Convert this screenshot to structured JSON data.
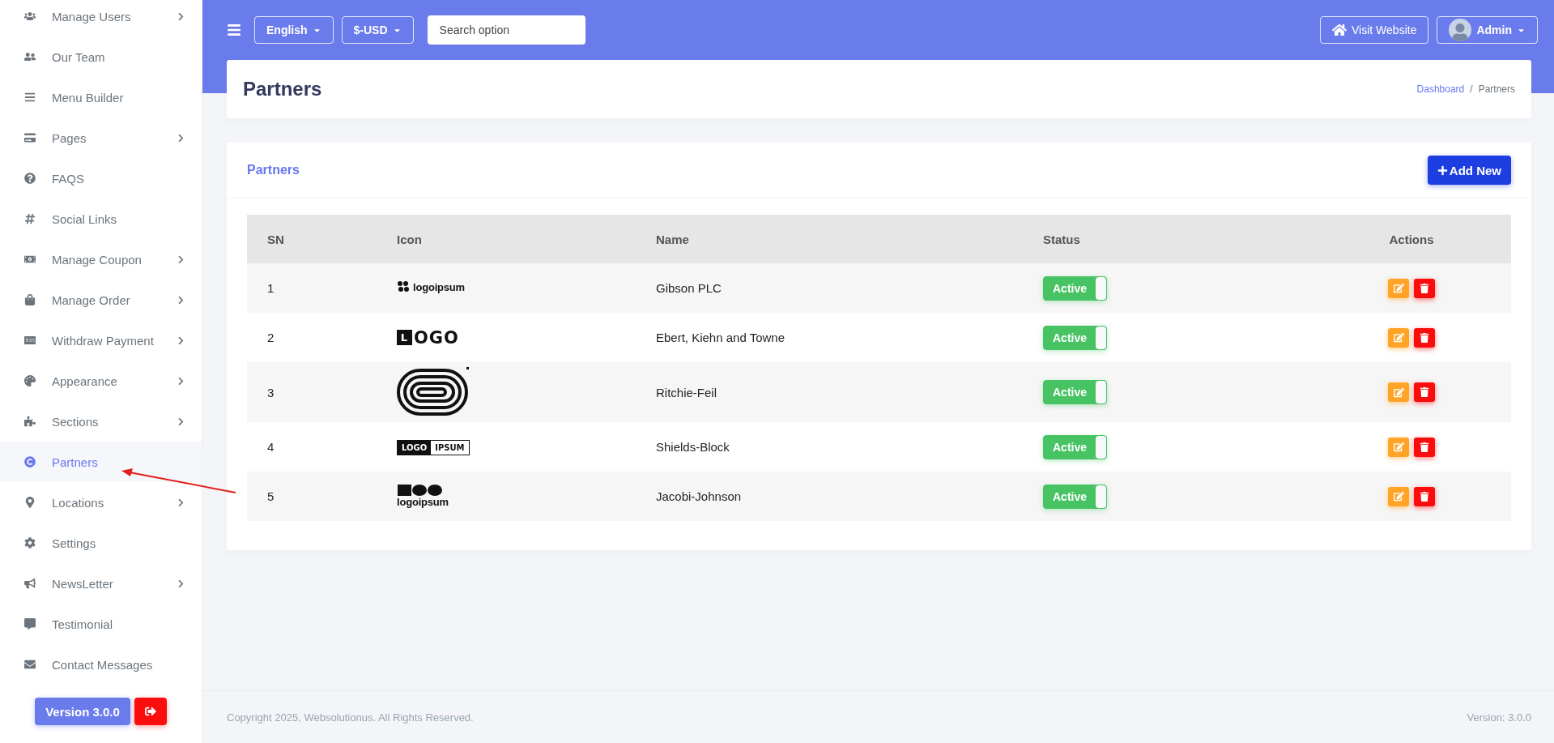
{
  "sidebar": {
    "items": [
      {
        "label": "Manage Users",
        "has_submenu": true,
        "selected": false
      },
      {
        "label": "Our Team",
        "has_submenu": false,
        "selected": false
      },
      {
        "label": "Menu Builder",
        "has_submenu": false,
        "selected": false
      },
      {
        "label": "Pages",
        "has_submenu": true,
        "selected": false
      },
      {
        "label": "FAQS",
        "has_submenu": false,
        "selected": false
      },
      {
        "label": "Social Links",
        "has_submenu": false,
        "selected": false
      },
      {
        "label": "Manage Coupon",
        "has_submenu": true,
        "selected": false
      },
      {
        "label": "Manage Order",
        "has_submenu": true,
        "selected": false
      },
      {
        "label": "Withdraw Payment",
        "has_submenu": true,
        "selected": false
      },
      {
        "label": "Appearance",
        "has_submenu": true,
        "selected": false
      },
      {
        "label": "Sections",
        "has_submenu": true,
        "selected": false
      },
      {
        "label": "Partners",
        "has_submenu": false,
        "selected": true
      },
      {
        "label": "Locations",
        "has_submenu": true,
        "selected": false
      },
      {
        "label": "Settings",
        "has_submenu": false,
        "selected": false
      },
      {
        "label": "NewsLetter",
        "has_submenu": true,
        "selected": false
      },
      {
        "label": "Testimonial",
        "has_submenu": false,
        "selected": false
      },
      {
        "label": "Contact Messages",
        "has_submenu": false,
        "selected": false
      }
    ],
    "version": "Version 3.0.0"
  },
  "topbar": {
    "language": "English",
    "currency": "$-USD",
    "search": {
      "placeholder": "Search option"
    },
    "visit_website": "Visit Website",
    "user": "Admin"
  },
  "page_header": {
    "title": "Partners",
    "breadcrumb_separator": "/",
    "breadcrumbs": [
      {
        "label": "Dashboard",
        "link": true
      },
      {
        "label": "Partners",
        "link": false
      }
    ]
  },
  "card": {
    "title": "Partners",
    "add_button": "Add New",
    "table": {
      "columns": [
        "SN",
        "Icon",
        "Name",
        "Status",
        "Actions"
      ],
      "rows": [
        {
          "sn": "1",
          "logo": {
            "kind": "mark-wordmark",
            "texts": [
              "logoipsum"
            ]
          },
          "name": "Gibson PLC",
          "status": {
            "label": "Active",
            "on": true
          }
        },
        {
          "sn": "2",
          "logo": {
            "kind": "boxed-letter",
            "texts": [
              "L",
              "OGO"
            ]
          },
          "name": "Ebert, Kiehn and Towne",
          "status": {
            "label": "Active",
            "on": true
          }
        },
        {
          "sn": "3",
          "logo": {
            "kind": "rings"
          },
          "name": "Ritchie-Feil",
          "status": {
            "label": "Active",
            "on": true
          }
        },
        {
          "sn": "4",
          "logo": {
            "kind": "split-bar",
            "texts": [
              "LOGO",
              "IPSUM"
            ]
          },
          "name": "Shields-Block",
          "status": {
            "label": "Active",
            "on": true
          }
        },
        {
          "sn": "5",
          "logo": {
            "kind": "shapes-wordmark",
            "texts": [
              "logoipsum"
            ]
          },
          "name": "Jacobi-Johnson",
          "status": {
            "label": "Active",
            "on": true
          }
        }
      ]
    }
  },
  "footer": {
    "copyright": "Copyright 2025, Websolutionus. All Rights Reserved.",
    "version": "Version: 3.0.0"
  }
}
